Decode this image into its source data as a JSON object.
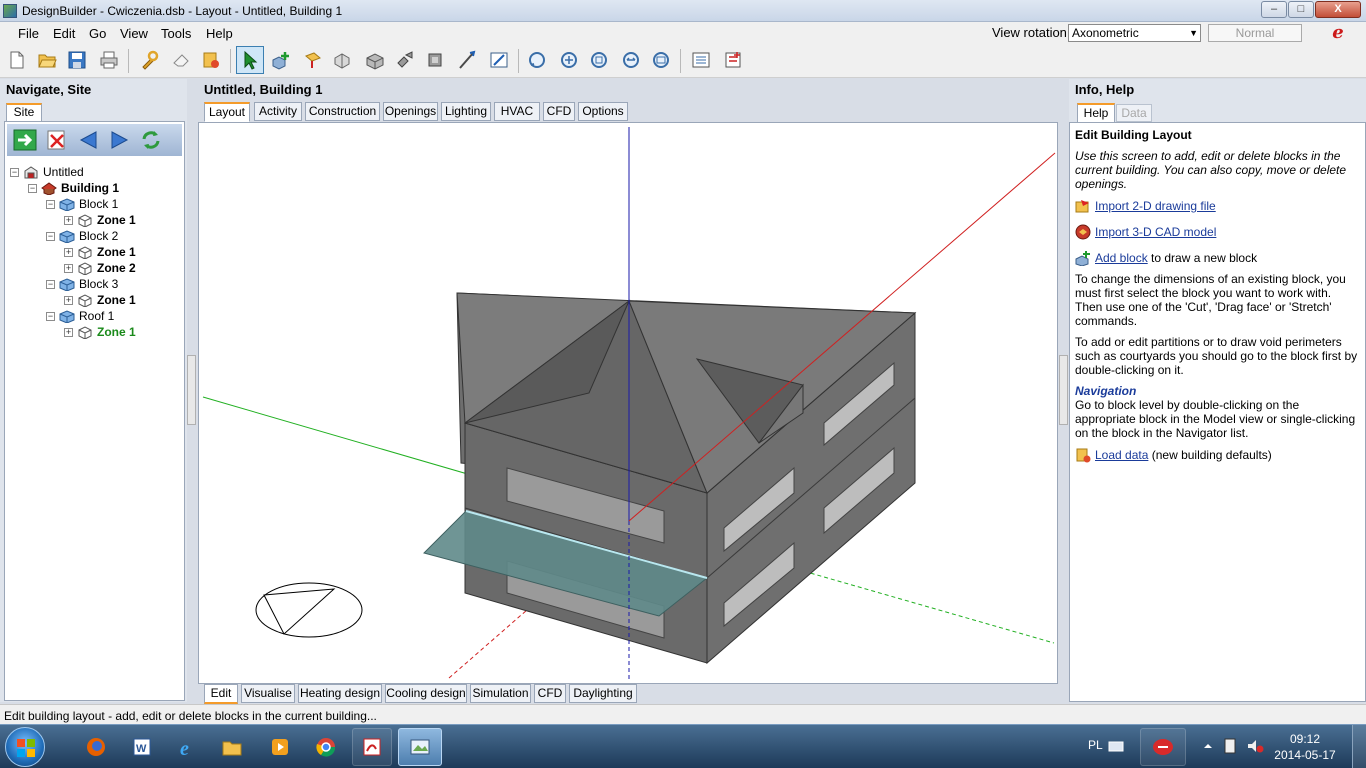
{
  "window": {
    "title": "DesignBuilder - Cwiczenia.dsb - Layout - Untitled, Building 1",
    "minimize_glyph": "–",
    "maximize_glyph": "□",
    "close_glyph": "X"
  },
  "menubar": {
    "items": [
      "File",
      "Edit",
      "Go",
      "View",
      "Tools",
      "Help"
    ],
    "view_rotation_label": "View rotation",
    "view_rotation_value": "Axonometric",
    "mode_value": "Normal"
  },
  "toolbar": {
    "icons": [
      "new-file-icon",
      "open-folder-icon",
      "save-icon",
      "print-icon",
      "model-options-icon",
      "eraser-icon",
      "model-data-icon",
      "select-arrow-icon",
      "add-block-icon",
      "drag-icon",
      "copy-icon",
      "cut-icon",
      "rotate-icon",
      "mirror-icon",
      "measure-icon",
      "edit-icon",
      "orbit-icon",
      "zoom-in-icon",
      "zoom-window-icon",
      "zoom-previous-icon",
      "zoom-extents-icon",
      "list-icon",
      "properties-icon"
    ]
  },
  "left_panel": {
    "title": "Navigate, Site",
    "tab": "Site",
    "tree": [
      {
        "label": "Untitled",
        "style": "normal",
        "icon": "site-icon"
      },
      {
        "label": "Building 1",
        "style": "bold",
        "icon": "building-icon"
      },
      {
        "label": "Block 1",
        "style": "normal",
        "icon": "block-icon"
      },
      {
        "label": "Zone 1",
        "style": "bold",
        "icon": "zone-icon"
      },
      {
        "label": "Block 2",
        "style": "normal",
        "icon": "block-icon"
      },
      {
        "label": "Zone 1",
        "style": "bold",
        "icon": "zone-icon"
      },
      {
        "label": "Zone 2",
        "style": "bold",
        "icon": "zone-icon"
      },
      {
        "label": "Block 3",
        "style": "normal",
        "icon": "block-icon"
      },
      {
        "label": "Zone 1",
        "style": "bold",
        "icon": "zone-icon"
      },
      {
        "label": "Roof 1",
        "style": "normal",
        "icon": "block-icon"
      },
      {
        "label": "Zone 1",
        "style": "green",
        "icon": "zone-icon"
      }
    ]
  },
  "center": {
    "title": "Untitled, Building 1",
    "top_tabs": [
      "Layout",
      "Activity",
      "Construction",
      "Openings",
      "Lighting",
      "HVAC",
      "CFD",
      "Options"
    ],
    "selected_top_tab": "Layout",
    "bottom_tabs": [
      "Edit",
      "Visualise",
      "Heating design",
      "Cooling design",
      "Simulation",
      "CFD",
      "Daylighting"
    ],
    "selected_bottom_tab": "Edit"
  },
  "right_panel": {
    "title": "Info, Help",
    "tabs": [
      "Help",
      "Data"
    ],
    "heading": "Edit Building Layout",
    "intro": "Use this screen to add, edit or delete blocks in the current building. You can also copy, move or delete openings.",
    "link_import_2d": "Import 2-D drawing file",
    "link_import_3d": "Import 3-D CAD model",
    "link_add_block": "Add block",
    "add_block_suffix": " to draw a new block",
    "para_change_dims": "To change the dimensions of an existing block, you must first select the block you want to work with. Then use one of the 'Cut', 'Drag face' or 'Stretch' commands.",
    "para_partitions": "To add or edit partitions or to draw void perimeters such as courtyards you should go to the block first by double-clicking on it.",
    "nav_heading": "Navigation",
    "nav_text": "Go to block level by double-clicking on the appropriate block in the Model view or single-clicking on the block in the Navigator list.",
    "link_load_data": "Load data",
    "load_data_suffix": " (new building defaults)"
  },
  "status": {
    "text": "Edit building layout - add, edit or delete blocks in the current building..."
  },
  "taskbar": {
    "lang": "PL",
    "time": "09:12",
    "date": "2014-05-17"
  }
}
